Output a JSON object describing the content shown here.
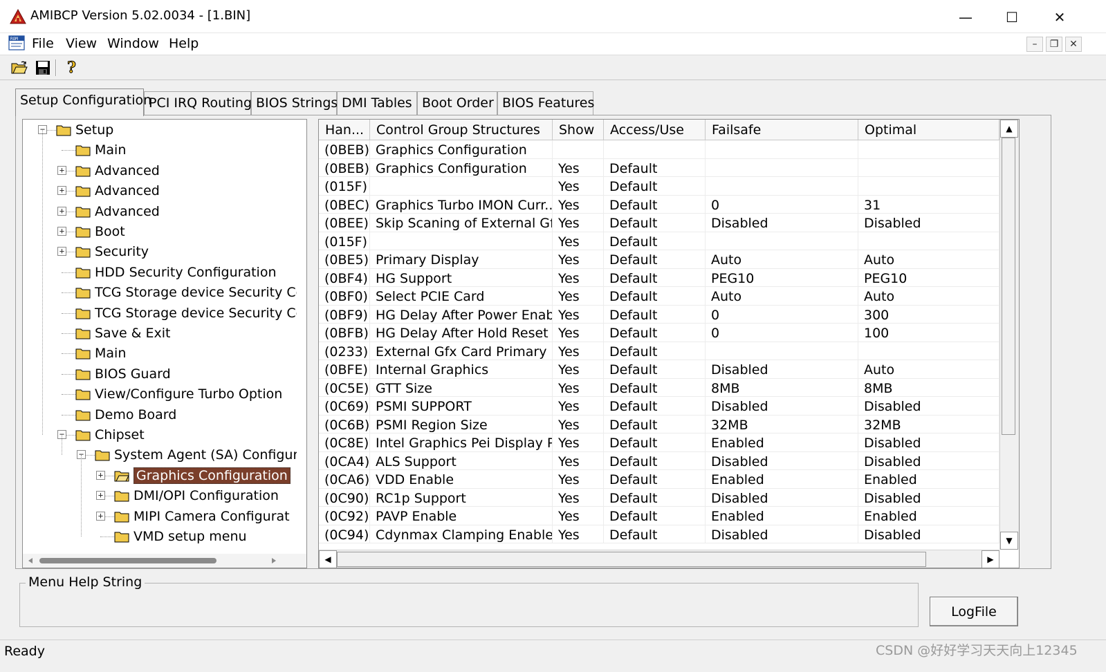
{
  "window": {
    "title": "AMIBCP Version 5.02.0034 - [1.BIN]",
    "min_glyph": "—",
    "max_glyph": "☐",
    "close_glyph": "✕"
  },
  "menu": {
    "items": [
      "File",
      "View",
      "Window",
      "Help"
    ],
    "mdi_min": "–",
    "mdi_restore": "❐",
    "mdi_close": "✕"
  },
  "tabs": [
    "Setup Configuration",
    "PCI IRQ Routing",
    "BIOS Strings",
    "DMI Tables",
    "Boot Order",
    "BIOS Features"
  ],
  "tree": [
    {
      "label": "Setup",
      "level": 0,
      "expander": "−"
    },
    {
      "label": "Main",
      "level": 1,
      "expander": ""
    },
    {
      "label": "Advanced",
      "level": 1,
      "expander": "+"
    },
    {
      "label": "Advanced",
      "level": 1,
      "expander": "+"
    },
    {
      "label": "Advanced",
      "level": 1,
      "expander": "+"
    },
    {
      "label": "Boot",
      "level": 1,
      "expander": "+"
    },
    {
      "label": "Security",
      "level": 1,
      "expander": "+"
    },
    {
      "label": "HDD Security Configuration",
      "level": 1,
      "expander": ""
    },
    {
      "label": "TCG Storage device Security Co",
      "level": 1,
      "expander": ""
    },
    {
      "label": "TCG Storage device Security Co",
      "level": 1,
      "expander": ""
    },
    {
      "label": "Save & Exit",
      "level": 1,
      "expander": ""
    },
    {
      "label": "Main",
      "level": 1,
      "expander": ""
    },
    {
      "label": "BIOS Guard",
      "level": 1,
      "expander": ""
    },
    {
      "label": " View/Configure Turbo Option",
      "level": 1,
      "expander": ""
    },
    {
      "label": "Demo Board",
      "level": 1,
      "expander": ""
    },
    {
      "label": "Chipset",
      "level": 1,
      "expander": "−"
    },
    {
      "label": "System Agent (SA) Configur",
      "level": 2,
      "expander": "−"
    },
    {
      "label": "Graphics Configuration",
      "level": 3,
      "expander": "+",
      "selected": true
    },
    {
      "label": "DMI/OPI Configuration",
      "level": 3,
      "expander": "+"
    },
    {
      "label": "MIPI Camera Configurat",
      "level": 3,
      "expander": "+"
    },
    {
      "label": "VMD setup menu",
      "level": 3,
      "expander": ""
    }
  ],
  "grid": {
    "columns": [
      "Han...",
      "Control Group Structures",
      "Show",
      "Access/Use",
      "Failsafe",
      "Optimal"
    ],
    "rows": [
      [
        "(0BEB)",
        "Graphics Configuration",
        "",
        "",
        "",
        ""
      ],
      [
        "(0BEB)",
        "Graphics Configuration",
        "Yes",
        "Default",
        "",
        ""
      ],
      [
        "(015F)",
        "",
        "Yes",
        "Default",
        "",
        ""
      ],
      [
        "(0BEC)",
        "Graphics Turbo IMON Curr...",
        "Yes",
        "Default",
        "0",
        "31"
      ],
      [
        "(0BEE)",
        "Skip Scaning of External Gf...",
        "Yes",
        "Default",
        "Disabled",
        "Disabled"
      ],
      [
        "(015F)",
        "",
        "Yes",
        "Default",
        "",
        ""
      ],
      [
        "(0BE5)",
        "Primary Display",
        "Yes",
        "Default",
        "Auto",
        "Auto"
      ],
      [
        "(0BF4)",
        "HG Support",
        "Yes",
        "Default",
        "PEG10",
        "PEG10"
      ],
      [
        "(0BF0)",
        "Select PCIE Card",
        "Yes",
        "Default",
        "Auto",
        "Auto"
      ],
      [
        "(0BF9)",
        "HG Delay After Power Enab...",
        "Yes",
        "Default",
        "0",
        "300"
      ],
      [
        "(0BFB)",
        "HG Delay After Hold Reset",
        "Yes",
        "Default",
        "0",
        "100"
      ],
      [
        "(0233)",
        "External Gfx Card Primary ...",
        "Yes",
        "Default",
        "",
        ""
      ],
      [
        "(0BFE)",
        "Internal Graphics",
        "Yes",
        "Default",
        "Disabled",
        "Auto"
      ],
      [
        "(0C5E)",
        "GTT Size",
        "Yes",
        "Default",
        "8MB",
        "8MB"
      ],
      [
        "(0C69)",
        "PSMI SUPPORT",
        "Yes",
        "Default",
        "Disabled",
        "Disabled"
      ],
      [
        "(0C6B)",
        "PSMI Region Size",
        "Yes",
        "Default",
        "32MB",
        "32MB"
      ],
      [
        "(0C8E)",
        "Intel Graphics Pei Display P...",
        "Yes",
        "Default",
        "Enabled",
        "Disabled"
      ],
      [
        "(0CA4)",
        "ALS Support",
        "Yes",
        "Default",
        "Disabled",
        "Disabled"
      ],
      [
        "(0CA6)",
        "VDD Enable",
        "Yes",
        "Default",
        "Enabled",
        "Enabled"
      ],
      [
        "(0C90)",
        "RC1p Support",
        "Yes",
        "Default",
        "Disabled",
        "Disabled"
      ],
      [
        "(0C92)",
        "PAVP Enable",
        "Yes",
        "Default",
        "Enabled",
        "Enabled"
      ],
      [
        "(0C94)",
        "Cdynmax Clamping Enable",
        "Yes",
        "Default",
        "Disabled",
        "Disabled"
      ]
    ]
  },
  "help": {
    "legend": "Menu Help String",
    "logfile_label": "LogFile"
  },
  "status": {
    "text": "Ready",
    "watermark": "CSDN @好好学习天天向上12345"
  },
  "colors": {
    "selection": "#7a3e2a",
    "chrome": "#f0f0f0"
  }
}
